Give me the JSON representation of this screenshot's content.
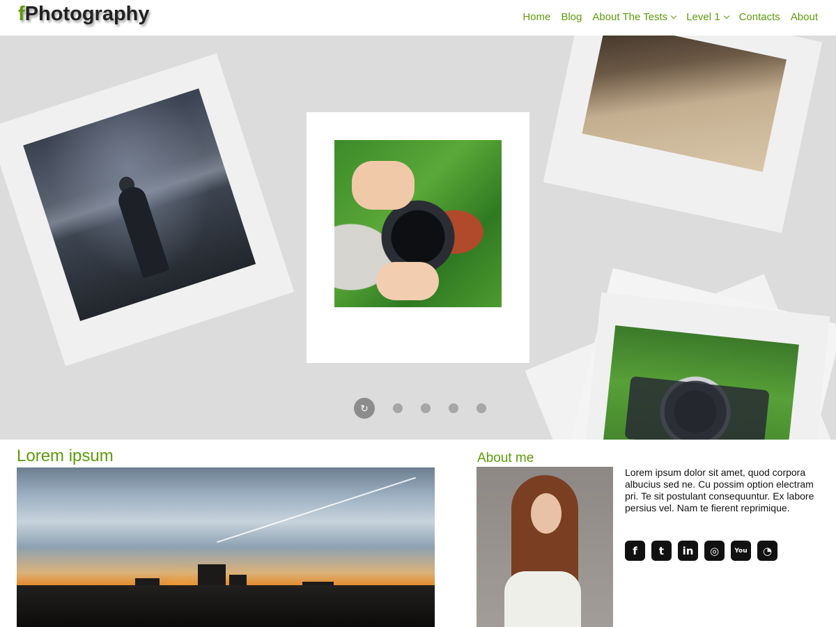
{
  "header": {
    "logo_f": "f",
    "logo_rest": "Photography",
    "nav": [
      {
        "label": "Home",
        "dropdown": false
      },
      {
        "label": "Blog",
        "dropdown": false
      },
      {
        "label": "About The Tests",
        "dropdown": true
      },
      {
        "label": "Level 1",
        "dropdown": true
      },
      {
        "label": "Contacts",
        "dropdown": false
      },
      {
        "label": "About",
        "dropdown": false
      }
    ]
  },
  "slider": {
    "active_dot_symbol": "↻",
    "dot_count": 5,
    "active_index": 0
  },
  "main": {
    "title": "Lorem ipsum"
  },
  "about": {
    "title": "About me",
    "text": "Lorem ipsum dolor sit amet, quod corpora albucius sed ne. Cu possim option electram pri. Te sit postulant consequuntur. Ex labore persius vel. Nam te fierent reprimique.",
    "social": [
      {
        "name": "facebook-icon",
        "glyph": "f"
      },
      {
        "name": "twitter-icon",
        "glyph": "t"
      },
      {
        "name": "linkedin-icon",
        "glyph": "in"
      },
      {
        "name": "instagram-icon",
        "glyph": "◎"
      },
      {
        "name": "youtube-icon",
        "glyph": "You"
      },
      {
        "name": "rss-icon",
        "glyph": "◔"
      }
    ]
  },
  "colors": {
    "accent": "#5d9c09",
    "slider_bg": "#dcdcdc"
  }
}
